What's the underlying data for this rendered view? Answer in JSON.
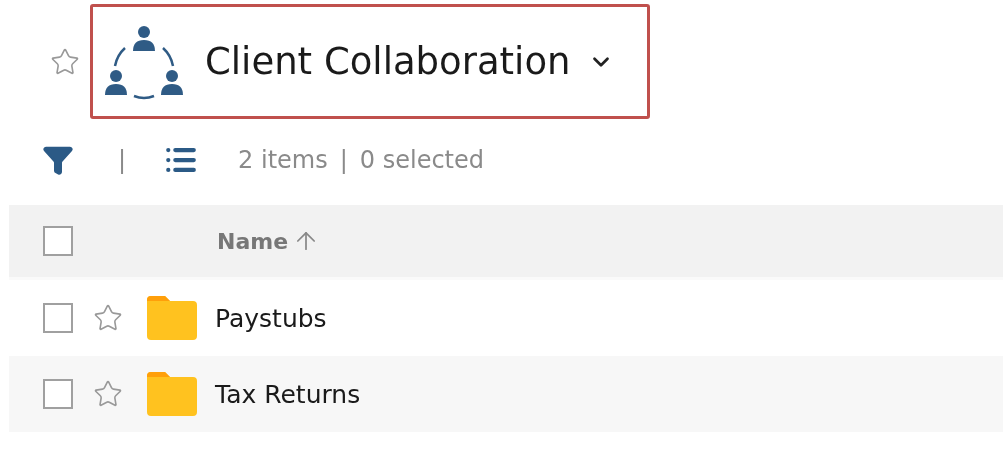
{
  "header": {
    "favorite": false,
    "title": "Client Collaboration",
    "highlighted": true
  },
  "toolbar": {
    "count": "2 items",
    "separator": "|",
    "selected": "0 selected"
  },
  "table": {
    "select_all": {
      "checked": false
    },
    "columns": [
      {
        "label": "Name",
        "sorted_ascending": true
      }
    ],
    "rows": [
      {
        "name": "Paystubs",
        "checked": false,
        "favorite": false,
        "kind": "folder"
      },
      {
        "name": "Tax Returns",
        "checked": false,
        "favorite": false,
        "kind": "folder"
      }
    ]
  }
}
